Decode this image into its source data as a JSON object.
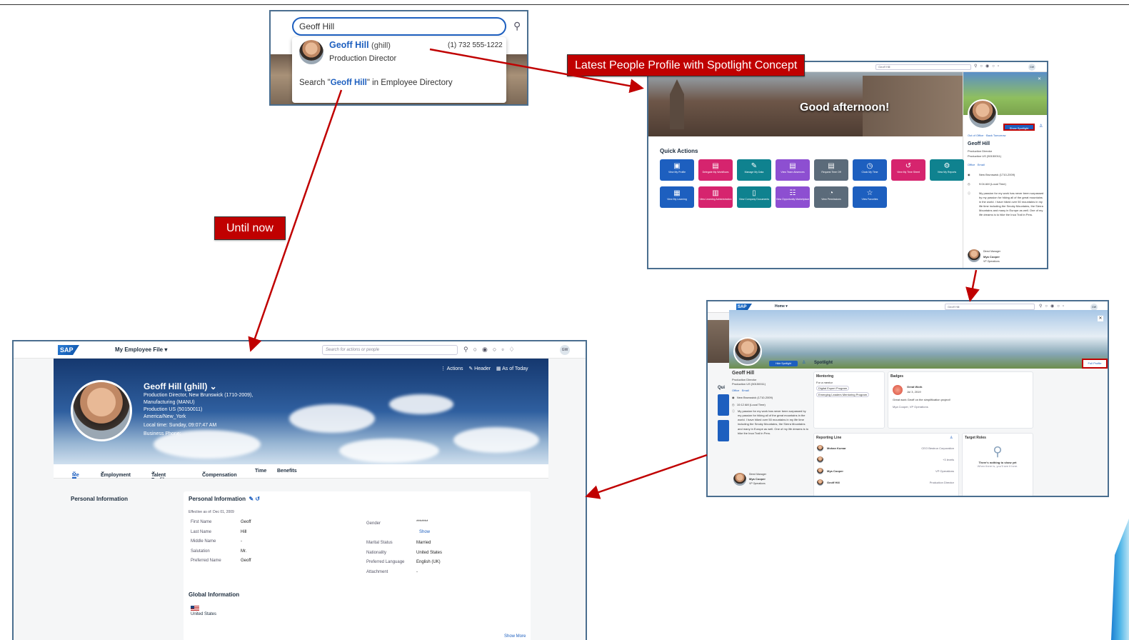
{
  "search_panel": {
    "query": "Geoff Hill",
    "result_name": "Geoff Hill",
    "result_id": "(ghill)",
    "result_title": "Production Director",
    "result_phone": "(1) 732 555-1222",
    "dir_prefix": "Search \"",
    "dir_query": "Geoff Hill",
    "dir_suffix": "\" in Employee Directory"
  },
  "callouts": {
    "latest": "Latest People Profile with Spotlight Concept",
    "until_now": "Until now"
  },
  "spotlight_panel": {
    "search_value": "Geoff Hill",
    "avatar": "GW",
    "greeting": "Good afternoon!",
    "quick_actions_title": "Quick Actions",
    "tiles": [
      {
        "label": "View My Profile",
        "color": "#1d5fbf",
        "icon": "id-card-icon",
        "glyph": "▣"
      },
      {
        "label": "Delegate My Workflows",
        "color": "#d6246e",
        "icon": "calendar-icon",
        "glyph": "▤"
      },
      {
        "label": "Manage My Data",
        "color": "#0f828f",
        "icon": "edit-icon",
        "glyph": "✎"
      },
      {
        "label": "View Team Absences",
        "color": "#8d4fd1",
        "icon": "calendar-icon",
        "glyph": "▤"
      },
      {
        "label": "Request Time Off",
        "color": "#5b6b7a",
        "icon": "calendar-icon",
        "glyph": "▤"
      },
      {
        "label": "Clock My Time",
        "color": "#1d5fbf",
        "icon": "clock-icon",
        "glyph": "◷"
      },
      {
        "label": "View My Time Sheet",
        "color": "#d6246e",
        "icon": "history-icon",
        "glyph": "↺"
      },
      {
        "label": "View My Reports",
        "color": "#0f828f",
        "icon": "settings-icon",
        "glyph": "⚙"
      },
      {
        "label": "View My Learning",
        "color": "#1d5fbf",
        "icon": "map-icon",
        "glyph": "▦"
      },
      {
        "label": "View Learning Administration",
        "color": "#d6246e",
        "icon": "learning-icon",
        "glyph": "▥"
      },
      {
        "label": "View Company Documents",
        "color": "#0f828f",
        "icon": "document-icon",
        "glyph": "▯"
      },
      {
        "label": "View Opportunity Marketplace",
        "color": "#8d4fd1",
        "icon": "marketplace-icon",
        "glyph": "☷"
      },
      {
        "label": "View Permissions",
        "color": "#5b6b7a",
        "icon": "time-icon",
        "glyph": "◔"
      },
      {
        "label": "View Favorites",
        "color": "#1d5fbf",
        "icon": "star-icon",
        "glyph": "☆"
      }
    ],
    "show_spotlight": "Show Spotlight",
    "status": "Out of Office",
    "status_extra": "· Back Tomorrow",
    "name": "Geoff Hill",
    "title": "Production Director",
    "org": "Production US (50150011)",
    "office": "Office",
    "email": "Email",
    "location": "New Brunswick (1710-2009)",
    "local_time": "9:04 AM (Local Time)",
    "bio": "My passion for my work has never been surpassed by my passion for hiking all of the great mountains in the world. I have hiked over 50 mountains in my life time including the Smoky Mountains, the Sierra Mountains and many in Europe as well. One of my life dreams is to hike the Inca Trail in Peru.",
    "manager_label": "Direct Manager",
    "manager_name": "Mya Cooper",
    "manager_title": "VP Operations"
  },
  "profile_panel": {
    "menu": "Home",
    "search_value": "Geoff Hill",
    "avatar": "GW",
    "hide_spotlight": "Hide Spotlight",
    "spotlight_title": "Spotlight",
    "full_profile": "Full Profile",
    "quick_partial": "Qui",
    "name": "Geoff Hill",
    "title": "Production Director",
    "org": "Production US (50150011)",
    "office": "Office",
    "email": "Email",
    "location": "New Brunswick (1710-2009)",
    "local_time": "10:12 AM (Local Time)",
    "bio": "My passion for my work has never been surpassed by my passion for hiking all of the great mountains in the world. I have hiked over 50 mountains in my life time including the Smoky Mountains, the Sierra Mountains and many in Europe as well. One of my life dreams is to hike the Inca Trail in Peru.",
    "manager_label": "Direct Manager",
    "manager_name": "Mya Cooper",
    "manager_title": "VP Operations",
    "mentoring_title": "Mentoring",
    "mentoring_sub": "For a mentor",
    "mentoring_chips": [
      "Digital Expert Program",
      "Emerging Leaders Mentoring Program"
    ],
    "badges_title": "Badges",
    "badge_name": "Great Work",
    "badge_date": "Jul 3, 2019",
    "badge_text": "Great work Geoff on the simplification project!",
    "badge_giver": "Mya Cooper, VP Operations",
    "reporting_title": "Reporting Line",
    "reporting": [
      {
        "name": "Mohan Kumar",
        "role": "CEO Bestrun Corporation"
      },
      {
        "name": "",
        "role": "+3 levels"
      },
      {
        "name": "Mya Cooper",
        "role": "VP Operations"
      },
      {
        "name": "Geoff Hill",
        "role": "Production Director"
      }
    ],
    "target_title": "Target Roles",
    "target_empty": "There's nothing to show yet",
    "target_empty_sub": "When there is, you'll see it here."
  },
  "employee_file": {
    "logo": "SAP",
    "app_title": "My Employee File",
    "search_placeholder": "Search for actions or people",
    "avatar": "GW",
    "name": "Geoff Hill (ghill)",
    "line1": "Production Director, New Brunswick (1710-2009),",
    "line2": "Manufacturing (MANU)",
    "line3": "Production US (50150011)",
    "line4": "America/New_York",
    "line5": "Local time: Sunday, 09:07:47 AM",
    "line6": "Business Phone:",
    "actions": "Actions",
    "header_btn": "Header",
    "as_of": "As of Today",
    "tabs": [
      "Me",
      "Employment",
      "Talent Profile",
      "Compensation",
      "Time",
      "Benefits"
    ],
    "section_label": "Personal Information",
    "card_title": "Personal Information",
    "effective": "Effective as of: Dec 01, 2009",
    "fields_left": [
      {
        "label": "First Name",
        "value": "Geoff"
      },
      {
        "label": "Last Name",
        "value": "Hill"
      },
      {
        "label": "Middle Name",
        "value": "-"
      },
      {
        "label": "Salutation",
        "value": "Mr."
      },
      {
        "label": "Preferred Name",
        "value": "Geoff"
      }
    ],
    "gender_label": "Gender",
    "gender_value": "*******",
    "show": "Show",
    "fields_right": [
      {
        "label": "Marital Status",
        "value": "Married"
      },
      {
        "label": "Nationality",
        "value": "United States"
      },
      {
        "label": "Preferred Language",
        "value": "English (UK)"
      },
      {
        "label": "Attachment",
        "value": "-"
      }
    ],
    "global_title": "Global Information",
    "country": "United States",
    "show_more": "Show More"
  }
}
